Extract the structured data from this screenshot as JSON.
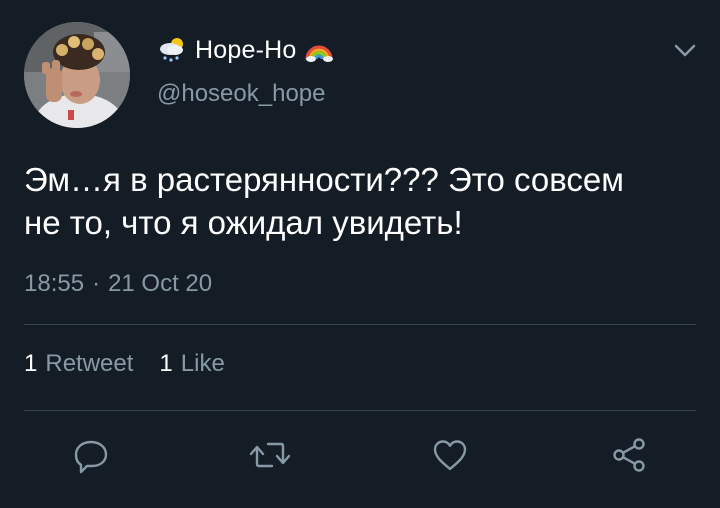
{
  "user": {
    "display_name": "Hope-Ho",
    "handle": "@hoseok_hope",
    "name_prefix_icon": "cloud-snow-sun-emoji-icon",
    "name_suffix_icon": "rainbow-emoji-icon",
    "avatar": "avatar-photo"
  },
  "tweet": {
    "text": "Эм…я в растерянности??? Это совсем\nне то, что я ожидал увидеть!",
    "time": "18:55",
    "separator": "·",
    "date": "21 Oct 20"
  },
  "stats": {
    "retweets_count": "1",
    "retweets_label": "Retweet",
    "likes_count": "1",
    "likes_label": "Like"
  },
  "actions": {
    "reply": "reply-icon",
    "retweet": "retweet-icon",
    "like": "heart-icon",
    "share": "share-icon"
  },
  "colors": {
    "background": "#141d26",
    "text": "#ffffff",
    "secondary_text": "#8899a6",
    "divider": "#38444d"
  }
}
